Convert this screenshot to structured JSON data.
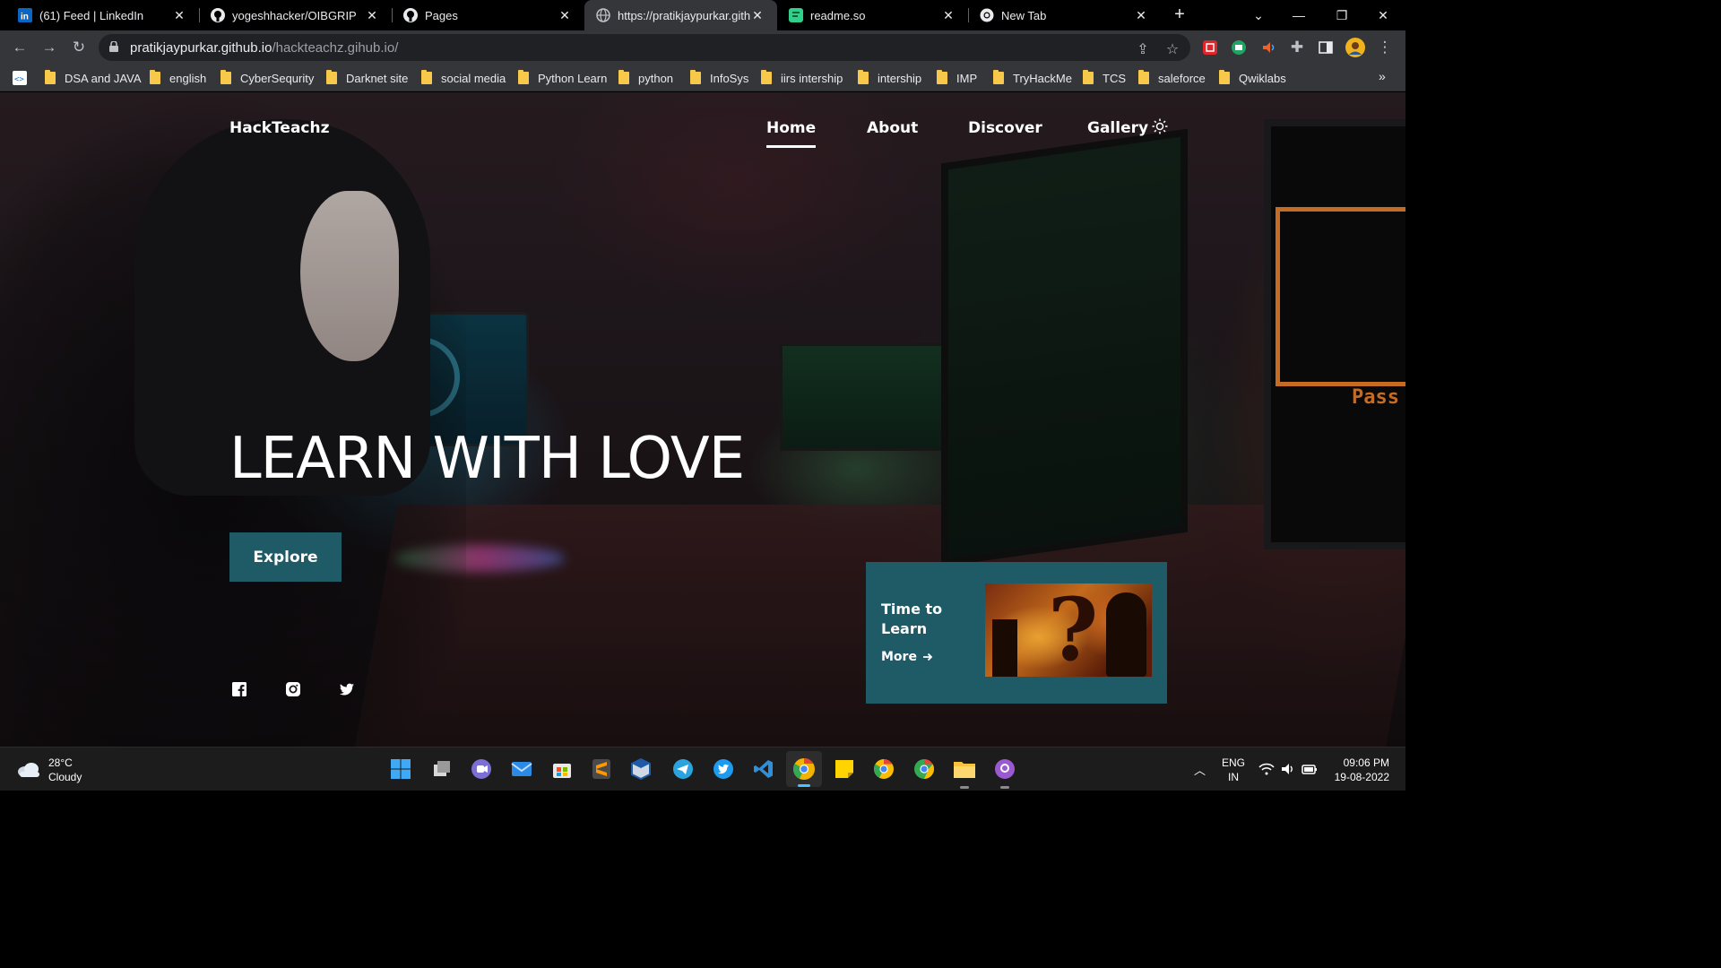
{
  "browser": {
    "tabs": [
      {
        "title": "(61) Feed | LinkedIn",
        "icon": "linkedin-icon"
      },
      {
        "title": "yogeshhacker/OIBGRIP",
        "icon": "github-icon"
      },
      {
        "title": "Pages",
        "icon": "github-icon"
      },
      {
        "title": "https://pratikjaypurkar.githu",
        "icon": "globe-icon",
        "active": true
      },
      {
        "title": "readme.so",
        "icon": "readme-icon"
      },
      {
        "title": "New Tab",
        "icon": "chrome-icon"
      }
    ],
    "url_host": "pratikjaypurkar.github.io",
    "url_path": "/hackteachz.gihub.io/",
    "bookmarks": [
      "DSA and JAVA",
      "english",
      "CyberSequrity",
      "Darknet site",
      "social media",
      "Python Learn",
      "python",
      "InfoSys",
      "iirs intership",
      "intership",
      "IMP",
      "TryHackMe",
      "TCS",
      "saleforce",
      "Qwiklabs"
    ]
  },
  "site": {
    "brand": "HackTeachz",
    "nav": {
      "home": "Home",
      "about": "About",
      "discover": "Discover",
      "gallery": "Gallery"
    },
    "active_nav": "Home",
    "headline": "LEARN WITH LOVE",
    "explore_label": "Explore",
    "card": {
      "title": "Time to Learn",
      "more": "More"
    },
    "accent_color": "#1f5b67",
    "social_icons": [
      "facebook-icon",
      "instagram-icon",
      "twitter-icon"
    ]
  },
  "taskbar": {
    "temperature": "28°C",
    "weather": "Cloudy",
    "lang_top": "ENG",
    "lang_bottom": "IN",
    "time": "09:06 PM",
    "date": "19-08-2022"
  }
}
